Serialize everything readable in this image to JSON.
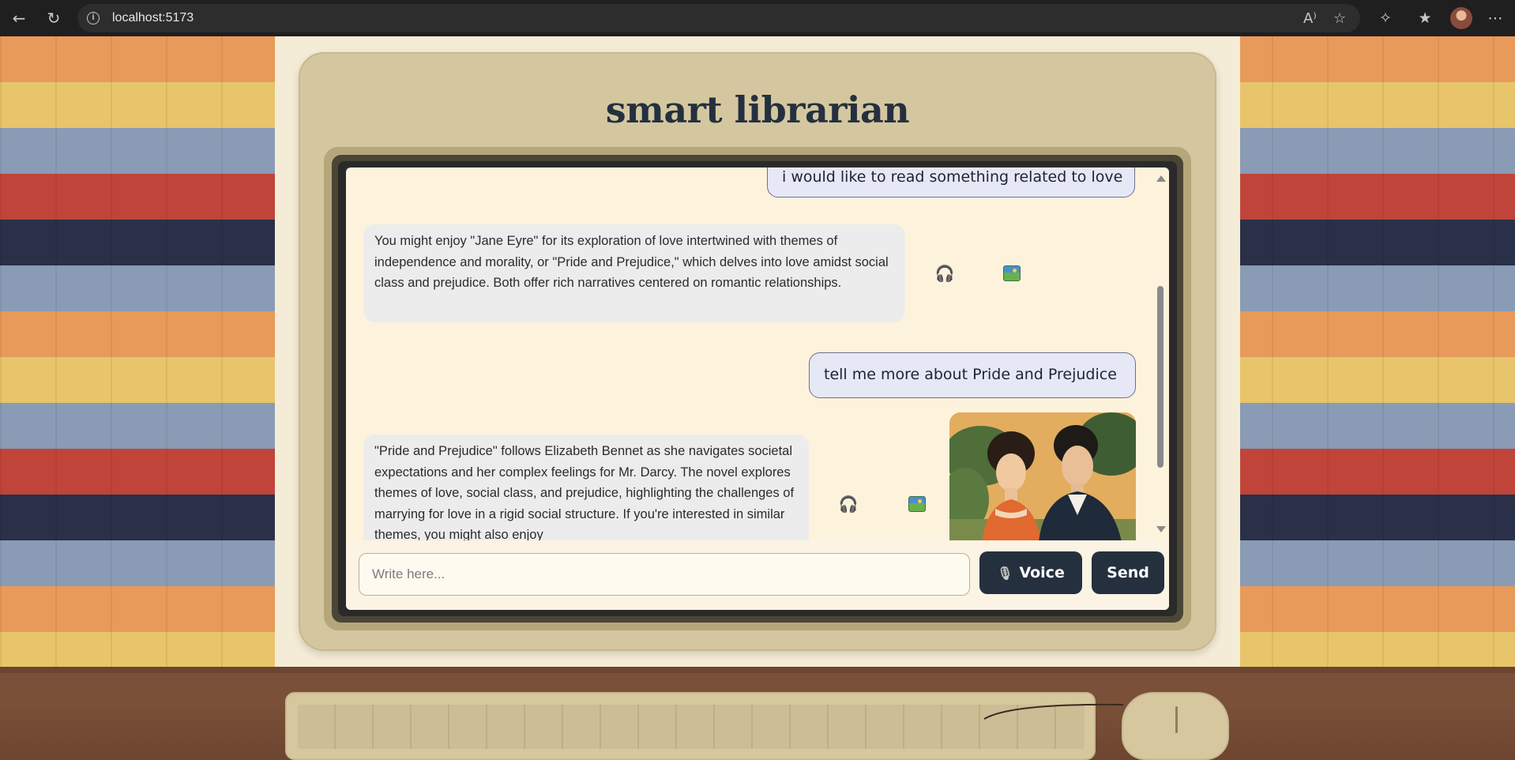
{
  "browser": {
    "url": "localhost:5173",
    "back_icon": "back-arrow-icon",
    "reload_icon": "reload-icon",
    "read_aloud_label": "A⁾",
    "icons": [
      "read-aloud-icon",
      "favorite-star-icon",
      "extensions-icon",
      "favorites-icon",
      "profile-avatar",
      "more-icon"
    ]
  },
  "app": {
    "title": "smart librarian"
  },
  "chat": {
    "messages": [
      {
        "role": "user",
        "text": "i would like to read something related to love"
      },
      {
        "role": "assistant",
        "text": "You might enjoy \"Jane Eyre\" for its exploration of love intertwined with themes of independence and morality, or \"Pride and Prejudice,\" which delves into love amidst social class and prejudice. Both offer rich narratives centered on romantic relationships.",
        "actions": [
          "headphones-icon",
          "image-icon"
        ]
      },
      {
        "role": "user",
        "text": "tell me more about Pride and Prejudice"
      },
      {
        "role": "assistant",
        "text": "\"Pride and Prejudice\" follows Elizabeth Bennet as she navigates societal expectations and her complex feelings for Mr. Darcy. The novel explores themes of love, social class, and prejudice, highlighting the challenges of marrying for love in a rigid social structure. If you're interested in similar themes, you might also enjoy",
        "actions": [
          "headphones-icon",
          "image-icon"
        ],
        "has_image": true
      }
    ]
  },
  "input": {
    "placeholder": "Write here...",
    "value": ""
  },
  "buttons": {
    "voice_label": "Voice",
    "send_label": "Send"
  },
  "colors": {
    "accent": "#25303f",
    "screen_bg": "#fdf3dc",
    "user_bubble": "#e6e8f5",
    "bot_bubble": "#ececec",
    "stripes": [
      "#e89a5a",
      "#e8c46a",
      "#8a9bb5",
      "#c0443a",
      "#2a3048",
      "#8a9bb5",
      "#e89a5a",
      "#e8c46a",
      "#8a9bb5",
      "#c0443a",
      "#2a3048",
      "#8a9bb5",
      "#e89a5a",
      "#e8c46a"
    ]
  }
}
